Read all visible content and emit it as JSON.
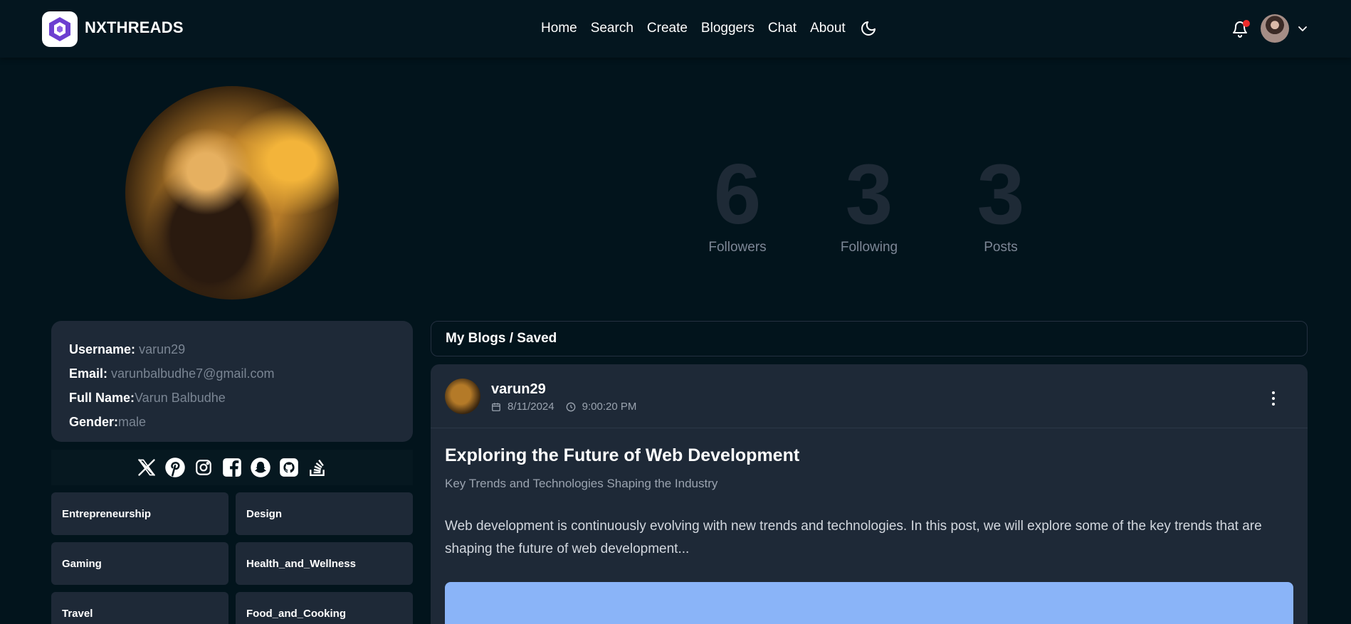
{
  "app": {
    "brand": "NXTHREADS",
    "logo_icon": "nxthreads-logo-icon"
  },
  "nav": {
    "links": [
      "Home",
      "Search",
      "Create",
      "Bloggers",
      "Chat",
      "About"
    ],
    "theme_icon": "moon-icon",
    "notification_icon": "bell-icon",
    "notification_dot_color": "#ef2b2b",
    "menu_icon": "chevron-down-icon"
  },
  "profile": {
    "stats": [
      {
        "value": "6",
        "label": "Followers"
      },
      {
        "value": "3",
        "label": "Following"
      },
      {
        "value": "3",
        "label": "Posts"
      }
    ],
    "info": {
      "username_key": "Username:",
      "username": "varun29",
      "email_key": "Email:",
      "email": "varunbalbudhe7@gmail.com",
      "fullname_key": "Full Name:",
      "fullname": "Varun Balbudhe",
      "gender_key": "Gender:",
      "gender": "male"
    },
    "socials": [
      "x-icon",
      "pinterest-icon",
      "instagram-icon",
      "facebook-icon",
      "snapchat-icon",
      "github-icon",
      "stackoverflow-icon"
    ],
    "categories": [
      "Entrepreneurship",
      "Design",
      "Gaming",
      "Health_and_Wellness",
      "Travel",
      "Food_and_Cooking"
    ]
  },
  "content": {
    "tabs_label": "My Blogs / Saved",
    "post": {
      "user": "varun29",
      "date": "8/11/2024",
      "time": "9:00:20 PM",
      "title": "Exploring the Future of Web Development",
      "subtitle": "Key Trends and Technologies Shaping the Industry",
      "excerpt": "Web development is continuously evolving with new trends and technologies. In this post, we will explore some of the key trends that are shaping the future of web development...",
      "image_color": "#8ab4f8"
    }
  },
  "colors": {
    "background": "#02141c",
    "card": "#1e2937",
    "muted_text": "#7a8593"
  }
}
